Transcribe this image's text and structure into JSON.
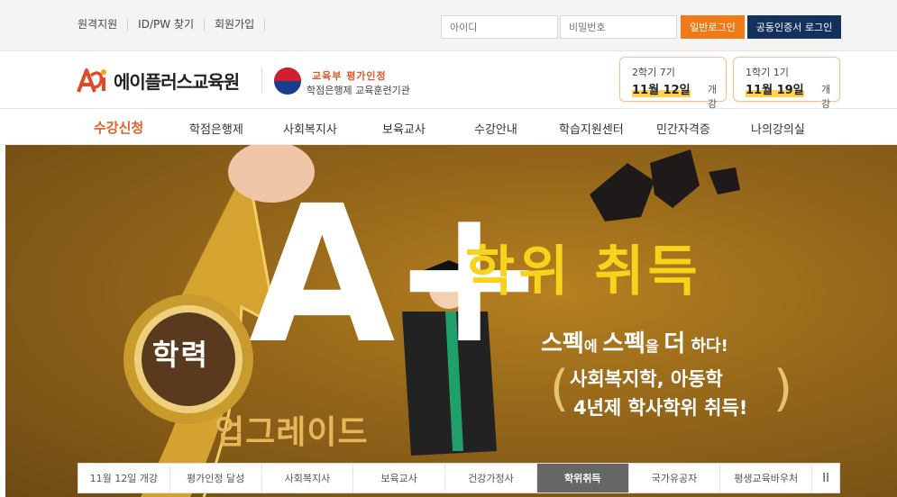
{
  "topbar": {
    "links": [
      "원격지원",
      "ID/PW 찾기",
      "회원가입"
    ],
    "id_placeholder": "아이디",
    "pw_placeholder": "비밀번호",
    "login_button": "일반로그인",
    "cert_login_button": "공동인증서 로그인"
  },
  "header": {
    "logo_text": "에이플러스교육원",
    "gov_line1": "교육부 평가인정",
    "gov_line2": "학점은행제 교육훈련기관",
    "semesters": [
      {
        "line1": "2학기 7기",
        "date": "11월 12일",
        "suffix": "개강"
      },
      {
        "line1": "1학기 1기",
        "date": "11월 19일",
        "suffix": "개강"
      }
    ]
  },
  "nav": {
    "items": [
      "수강신청",
      "학점은행제",
      "사회복지사",
      "보육교사",
      "수강안내",
      "학습지원센터",
      "민간자격증",
      "나의강의실"
    ]
  },
  "banner": {
    "aplus": "A+",
    "headline": "학위 취득",
    "spec_line": [
      "스펙",
      "에 ",
      "스펙",
      "을 ",
      "더",
      " 하다!"
    ],
    "degree_line1": "사회복지학, 아동학",
    "degree_line2": "4년제 학사학위 취득!",
    "badge": "학력",
    "upgrade": "업그레이드"
  },
  "tabs": {
    "items": [
      "11월 12일 개강",
      "평가인정 달성",
      "사회복지사",
      "보육교사",
      "건강가정사",
      "학위취득",
      "국가유공자",
      "평생교육바우처"
    ],
    "active_index": 5,
    "pause_label": "II"
  },
  "colors": {
    "accent": "#f07a1a",
    "nav_active": "#e0612a",
    "navy_button": "#13315c",
    "headline_yellow": "#f7d31c"
  }
}
